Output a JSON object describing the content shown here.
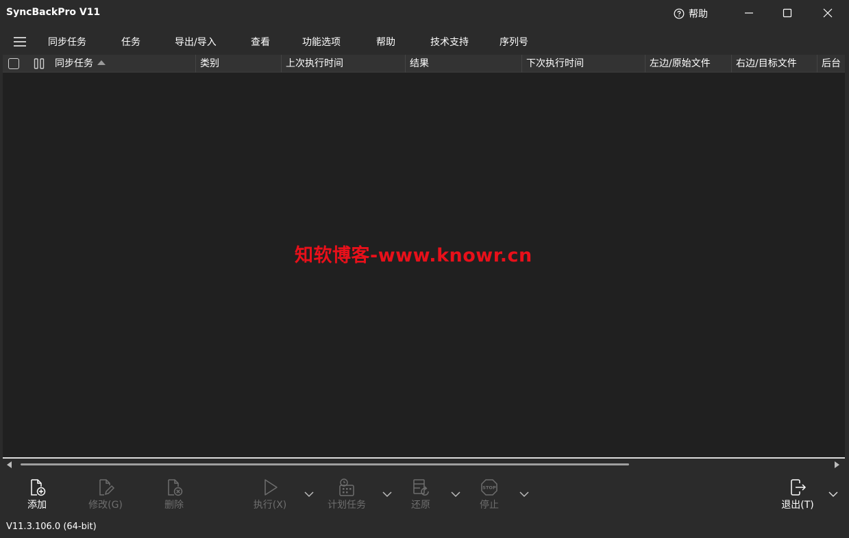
{
  "window": {
    "title": "SyncBackPro V11",
    "help_label": "帮助",
    "icons": [
      "help-circle-icon",
      "minimize-icon",
      "maximize-icon",
      "close-icon"
    ]
  },
  "menu": {
    "items": [
      "同步任务",
      "任务",
      "导出/导入",
      "查看",
      "功能选项",
      "帮助",
      "技术支持",
      "序列号"
    ]
  },
  "table": {
    "columns": [
      "同步任务",
      "类别",
      "上次执行时间",
      "结果",
      "下次执行时间",
      "左边/原始文件",
      "右边/目标文件",
      "后台"
    ],
    "sorted_column": "同步任务",
    "sort_direction": "ascending",
    "rows": []
  },
  "watermark": "知软博客-www.knowr.cn",
  "toolbar": {
    "add": "添加",
    "modify": "修改(G)",
    "delete": "删除",
    "run": "执行(X)",
    "schedule": "计划任务",
    "restore": "还原",
    "stop": "停止",
    "exit": "退出(T)"
  },
  "status": {
    "version": "V11.3.106.0 (64-bit)"
  },
  "colors": {
    "background": "#2b2b2b",
    "table_bg": "#202020",
    "header_bg": "#333333",
    "watermark": "#e8101a",
    "disabled_text": "#6e6e6e"
  }
}
